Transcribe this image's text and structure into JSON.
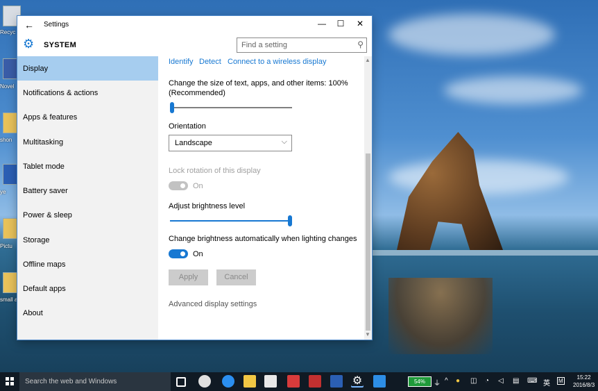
{
  "desktop": {
    "icons": [
      "Recyc",
      "Novel",
      "shon",
      "ye",
      "Pictu",
      "small a"
    ]
  },
  "window": {
    "title": "Settings",
    "controls": {
      "minimize": "—",
      "maximize": "☐",
      "close": "✕"
    },
    "back_glyph": "←"
  },
  "header": {
    "icon": "gear-icon",
    "title": "SYSTEM",
    "search_placeholder": "Find a setting",
    "search_icon": "search-icon"
  },
  "sidebar": {
    "items": [
      {
        "label": "Display",
        "active": true
      },
      {
        "label": "Notifications & actions"
      },
      {
        "label": "Apps & features"
      },
      {
        "label": "Multitasking"
      },
      {
        "label": "Tablet mode"
      },
      {
        "label": "Battery saver"
      },
      {
        "label": "Power & sleep"
      },
      {
        "label": "Storage"
      },
      {
        "label": "Offline maps"
      },
      {
        "label": "Default apps"
      },
      {
        "label": "About"
      }
    ]
  },
  "content": {
    "links": {
      "identify": "Identify",
      "detect": "Detect",
      "wireless": "Connect to a wireless display"
    },
    "scale_label_line1": "Change the size of text, apps, and other items: 100%",
    "scale_label_line2": "(Recommended)",
    "scale_level": 0,
    "orientation_label": "Orientation",
    "orientation_value": "Landscape",
    "lock_rotation_label": "Lock rotation of this display",
    "lock_rotation_state": "On",
    "brightness_label": "Adjust brightness level",
    "brightness_level": 1.0,
    "auto_brightness_label": "Change brightness automatically when lighting changes",
    "auto_brightness_state": "On",
    "apply_label": "Apply",
    "cancel_label": "Cancel",
    "advanced_label": "Advanced display settings"
  },
  "taskbar": {
    "search_text": "Search the web and Windows",
    "battery": "54%",
    "ime": "英",
    "time": "15:22",
    "date": "2016/8/3"
  },
  "colors": {
    "accent": "#1778d2",
    "nav_active": "#a6cdef",
    "taskbar": "#101a24"
  }
}
